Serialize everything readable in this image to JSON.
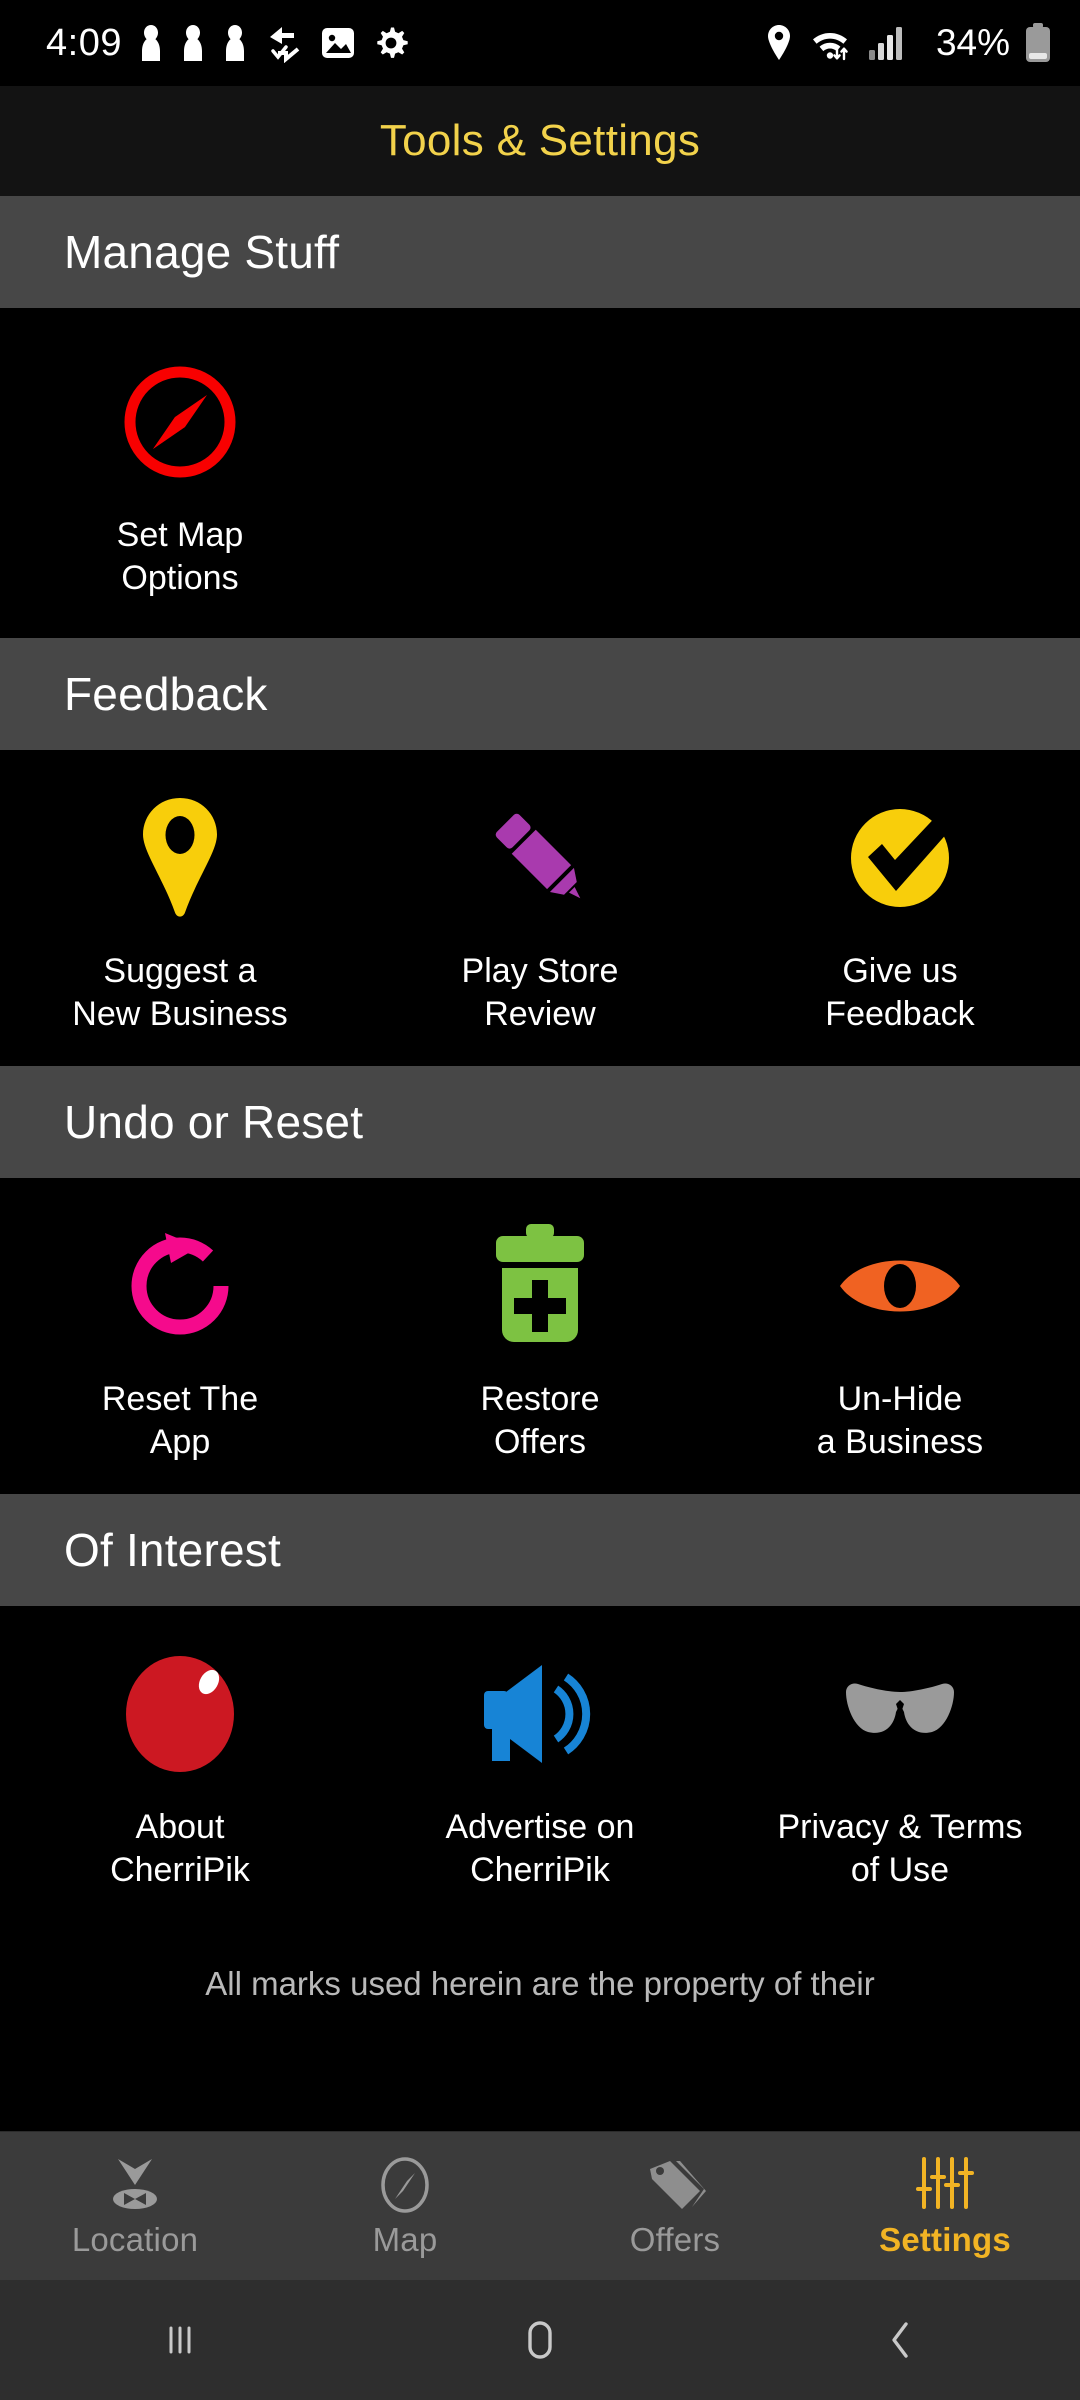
{
  "status_bar": {
    "time": "4:09",
    "battery_percent": "34%",
    "left_icons": [
      "person-icon",
      "person-icon",
      "person-icon",
      "sync-check-icon",
      "image-icon",
      "gear-icon"
    ],
    "right_icons": [
      "location-pin-icon",
      "wifi-icon",
      "signal-bars-icon",
      "battery-icon"
    ]
  },
  "header": {
    "title": "Tools & Settings",
    "title_color": "#F2D24B"
  },
  "sections": [
    {
      "title": "Manage Stuff",
      "tiles": [
        {
          "label": "Set Map\nOptions",
          "icon": "compass-icon",
          "color": "#F80000"
        }
      ]
    },
    {
      "title": "Feedback",
      "tiles": [
        {
          "label": "Suggest a\nNew Business",
          "icon": "map-pin-icon",
          "color": "#F8CE0B"
        },
        {
          "label": "Play Store\nReview",
          "icon": "crayon-icon",
          "color": "#A93AAE"
        },
        {
          "label": "Give us\nFeedback",
          "icon": "check-circle-icon",
          "color": "#F8CE0B"
        }
      ]
    },
    {
      "title": "Undo or Reset",
      "tiles": [
        {
          "label": "Reset The\nApp",
          "icon": "refresh-arrow-icon",
          "color": "#F50A8C"
        },
        {
          "label": "Restore\nOffers",
          "icon": "trash-plus-icon",
          "color": "#7DC242"
        },
        {
          "label": "Un-Hide\na Business",
          "icon": "eye-icon",
          "color": "#F06222"
        }
      ]
    },
    {
      "title": "Of Interest",
      "tiles": [
        {
          "label": "About\nCherriPik",
          "icon": "cherry-ball-icon",
          "color": "#CC1822"
        },
        {
          "label": "Advertise on\nCherriPik",
          "icon": "megaphone-icon",
          "color": "#1784D6"
        },
        {
          "label": "Privacy & Terms\nof Use",
          "icon": "sunglasses-icon",
          "color": "#9A9A9A"
        }
      ]
    }
  ],
  "footer_note": "All marks used herein are the property of their",
  "tabbar": {
    "active": "Settings",
    "active_color": "#F2B424",
    "items": [
      {
        "label": "Location",
        "icon": "location-marker-icon"
      },
      {
        "label": "Map",
        "icon": "compass-icon"
      },
      {
        "label": "Offers",
        "icon": "tags-icon"
      },
      {
        "label": "Settings",
        "icon": "sliders-icon"
      }
    ]
  },
  "navbar": {
    "items": [
      {
        "name": "recents",
        "icon": "recents-icon"
      },
      {
        "name": "home",
        "icon": "home-icon"
      },
      {
        "name": "back",
        "icon": "back-icon"
      }
    ]
  }
}
